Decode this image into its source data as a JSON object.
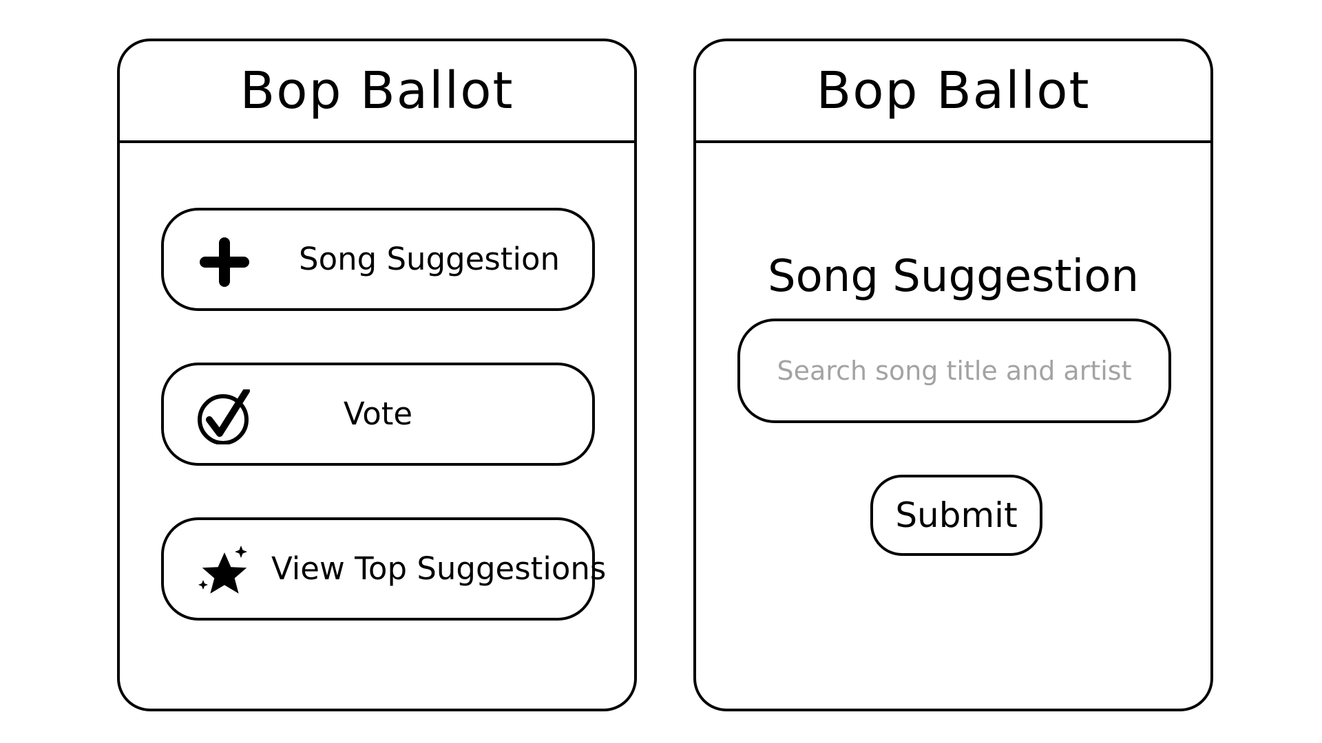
{
  "app": {
    "title": "Bop Ballot"
  },
  "home_screen": {
    "menu": [
      {
        "label": "Song Suggestion",
        "icon": "plus-icon"
      },
      {
        "label": "Vote",
        "icon": "check-circle-icon"
      },
      {
        "label": "View Top Suggestions",
        "icon": "sparkle-star-icon"
      }
    ]
  },
  "suggestion_screen": {
    "heading": "Song Suggestion",
    "search": {
      "placeholder": "Search song title and artist",
      "value": ""
    },
    "submit_label": "Submit"
  },
  "colors": {
    "stroke": "#000000",
    "background": "#ffffff",
    "placeholder": "#a3a3a3"
  }
}
